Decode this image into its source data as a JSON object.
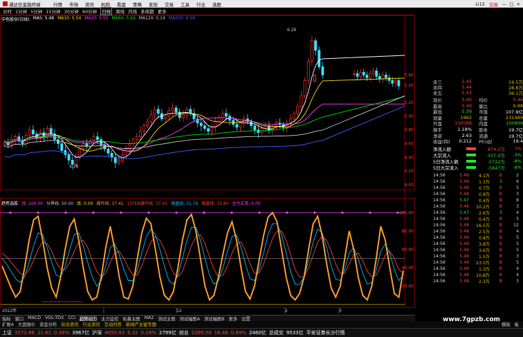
{
  "menubar": {
    "app_title": "通达信金融终端",
    "items": [
      "行情",
      "市场",
      "资讯",
      "机构",
      "看盘",
      "策略",
      "发现",
      "交易",
      "工具",
      "行业",
      "选股"
    ],
    "account": "Li12",
    "trade_label": "交易",
    "window_controls": [
      "—",
      "□",
      "×"
    ]
  },
  "periods": {
    "items": [
      "分时",
      "1分钟",
      "5分钟",
      "15分钟",
      "30分钟",
      "60分钟",
      "日线",
      "周线",
      "月线",
      "多周期",
      "更多"
    ],
    "selected": "日线"
  },
  "ma_legend": [
    {
      "text": "中色股份(日线)",
      "color": "#ffffff"
    },
    {
      "text": "MA5: 5.48",
      "color": "#ffffff"
    },
    {
      "text": "MA10: 5.54",
      "color": "#ffe000"
    },
    {
      "text": "MA20: 5.55",
      "color": "#ff40ff"
    },
    {
      "text": "MA60: 5.64",
      "color": "#00e000"
    },
    {
      "text": "MA120: 5.14",
      "color": "#cccccc"
    },
    {
      "text": "MA250: 4.59",
      "color": "#4060ff"
    }
  ],
  "ind_legend": [
    {
      "text": "趋势选股",
      "color": "#ffffff"
    },
    {
      "text": "顶: 100.00",
      "color": "#ff40ff"
    },
    {
      "text": "分界线: 50.00",
      "color": "#cccccc"
    },
    {
      "text": "底: 0.00",
      "color": "#ffe000"
    },
    {
      "text": "操作线: 37.41",
      "color": "#ffa030"
    },
    {
      "text": "10TEN操作线: 37.41",
      "color": "#ff4040"
    },
    {
      "text": "操盘线: 31.79",
      "color": "#00c0ff"
    },
    {
      "text": "操盘线: 33.80",
      "color": "#ff4040"
    },
    {
      "text": "主力买单: 0.00",
      "color": "#ff40ff"
    }
  ],
  "price_axis": [
    "5.60",
    "5.45",
    "5.20",
    "5.00",
    "4.80",
    "4.60",
    "4.40",
    "4.20",
    "4.00"
  ],
  "ind_axis": [
    "100.00",
    "80.00",
    "60.00",
    "40.00",
    "20.00"
  ],
  "price_marks": {
    "high": "6.26",
    "low": "4.28"
  },
  "x_axis": {
    "year": "2022年",
    "months": [
      "12",
      "2",
      "3"
    ]
  },
  "quote": {
    "asks": [
      {
        "label": "卖三",
        "price": "5.45",
        "vol": "19.5万"
      },
      {
        "label": "卖四",
        "price": "5.44",
        "vol": "28.8万"
      },
      {
        "label": "卖五",
        "price": "5.43",
        "vol": "36.1万"
      }
    ],
    "stats": [
      {
        "k1": "现价",
        "v1": "5.40",
        "c1": "red",
        "k2": "均价",
        "v2": "5.46",
        "c2": "red"
      },
      {
        "k1": "最高",
        "v1": "5.49",
        "c1": "red",
        "k2": "量比",
        "v2": "0.98",
        "c2": "yel"
      },
      {
        "k1": "最低",
        "v1": "5.39",
        "c1": "grn",
        "k2": "市值",
        "v2": "107.9亿",
        "c2": "wht"
      },
      {
        "k1": "现量",
        "v1": "1962",
        "c1": "yel",
        "k2": "总量",
        "v2": "231489",
        "c2": "yel"
      },
      {
        "k1": "外盘",
        "v1": "130588",
        "c1": "red",
        "k2": "内盘",
        "v2": "100899",
        "c2": "grn"
      },
      {
        "k1": "换手",
        "v1": "1.18%",
        "c1": "wht",
        "k2": "股本",
        "v2": "19.7亿",
        "c2": "wht"
      },
      {
        "k1": "净资",
        "v1": "2.63",
        "c1": "wht",
        "k2": "流通",
        "v2": "19.7亿",
        "c2": "wht"
      },
      {
        "k1": "收益(四)",
        "v1": "0.212",
        "c1": "wht",
        "k2": "PE(动)",
        "v2": "19.4",
        "c2": "wht"
      }
    ],
    "flows": [
      {
        "k": "净流入额",
        "v": "874.2万",
        "p": "7%",
        "c": "red"
      },
      {
        "k": "大宗流入",
        "v": "-337.0万",
        "p": "-3%",
        "c": "grn"
      },
      {
        "k": "5日净流入额",
        "v": "-5722万",
        "p": "-8%",
        "c": "grn"
      },
      {
        "k": "5日大宗流入",
        "v": "-5647万",
        "p": "-8%",
        "c": "grn"
      }
    ],
    "ticks": [
      {
        "t": "14:56",
        "p": "5.48",
        "q": "4.1万",
        "s": "B",
        "n": "2"
      },
      {
        "t": "14:56",
        "p": "5.48",
        "q": "1.3万",
        "s": "S",
        "n": "6"
      },
      {
        "t": "14:56",
        "p": "5.48",
        "q": "0.7万",
        "s": "B",
        "n": "5"
      },
      {
        "t": "14:56",
        "p": "5.48",
        "q": "0.8万",
        "s": "B",
        "n": "3"
      },
      {
        "t": "14:56",
        "p": "5.47",
        "q": "0.4万",
        "s": "B",
        "n": "8"
      },
      {
        "t": "14:56",
        "p": "5.48",
        "q": "10.2万",
        "s": "B",
        "n": "3"
      },
      {
        "t": "14:56",
        "p": "5.47",
        "q": "2.6万",
        "s": "S",
        "n": "4"
      },
      {
        "t": "14:56",
        "p": "5.48",
        "q": "0.4万",
        "s": "B",
        "n": "5"
      },
      {
        "t": "14:56",
        "p": "5.48",
        "q": "16.5万",
        "s": "B",
        "n": "12"
      },
      {
        "t": "14:56",
        "p": "5.48",
        "q": "2.5万",
        "s": "B",
        "n": "4"
      },
      {
        "t": "14:56",
        "p": "5.48",
        "q": "0.8万",
        "s": "B",
        "n": "5"
      },
      {
        "t": "14:56",
        "p": "5.48",
        "q": "3.8万",
        "s": "B",
        "n": "5"
      },
      {
        "t": "14:56",
        "p": "5.48",
        "q": "3.6万",
        "s": "B",
        "n": "5"
      },
      {
        "t": "14:56",
        "p": "5.48",
        "q": "1.5万",
        "s": "B",
        "n": "3"
      },
      {
        "t": "14:56",
        "p": "5.48",
        "q": "23.0万",
        "s": "B",
        "n": "5"
      },
      {
        "t": "14:56",
        "p": "5.48",
        "q": "1.3万",
        "s": "B",
        "n": "4"
      },
      {
        "t": "14:56",
        "p": "5.48",
        "q": "10.8万",
        "s": "B",
        "n": "4"
      },
      {
        "t": "14:56",
        "p": "5.48",
        "q": "2.3万",
        "s": "B",
        "n": "3"
      }
    ]
  },
  "tabs": [
    "指标",
    "窗口",
    "MACD",
    "VOL-TDX",
    "CCI",
    "趋势动力",
    "主力监控",
    "私募主图",
    "MA2",
    "测试主图",
    "测试幅图A",
    "测试幅图B",
    "更多",
    "设置"
  ],
  "tabs_selected": "趋势动力",
  "tabs2": [
    "扩展A",
    "大盘报价",
    "资金分布",
    "综合资讯",
    "行业资讯",
    "互动问答",
    "新闻产业链专题"
  ],
  "tabs2_right": [
    "模板",
    "板"
  ],
  "status": {
    "items": [
      {
        "text": "上证",
        "c": "wht"
      },
      {
        "text": "3272.86",
        "c": "red"
      },
      {
        "text": "11.61",
        "c": "red"
      },
      {
        "text": "0.36%",
        "c": "red"
      },
      {
        "text": "3967亿",
        "c": "wht"
      },
      {
        "text": "沪深",
        "c": "wht"
      },
      {
        "text": "4050.93",
        "c": "red"
      },
      {
        "text": "6.32",
        "c": "red"
      },
      {
        "text": "0.16%",
        "c": "red"
      },
      {
        "text": "2799亿",
        "c": "wht"
      },
      {
        "text": "创业",
        "c": "wht"
      },
      {
        "text": "2399.50",
        "c": "red"
      },
      {
        "text": "16.46",
        "c": "red"
      },
      {
        "text": "0.69%",
        "c": "red"
      },
      {
        "text": "2460亿",
        "c": "wht"
      },
      {
        "text": "总成交",
        "c": "wht"
      },
      {
        "text": "9533亿",
        "c": "wht"
      },
      {
        "text": "平安证券长沙行情",
        "c": "wht"
      }
    ]
  },
  "watermark": "www.7gpzb.com",
  "chart_data": [
    {
      "type": "candlestick",
      "title": "中色股份(日线)",
      "ylim": [
        3.95,
        6.35
      ],
      "high_label": "6.26",
      "low_label": "4.28",
      "series": [
        {
          "name": "MA5",
          "color": "#ffffff"
        },
        {
          "name": "MA10",
          "color": "#ffe000"
        },
        {
          "name": "MA20",
          "color": "#ff40ff"
        },
        {
          "name": "MA60",
          "color": "#00e000"
        },
        {
          "name": "MA120",
          "color": "#cccccc"
        },
        {
          "name": "MA250",
          "color": "#4060ff"
        }
      ],
      "close": [
        4.62,
        4.58,
        4.66,
        4.7,
        4.64,
        4.6,
        4.72,
        4.8,
        4.74,
        4.68,
        4.76,
        4.7,
        4.82,
        4.74,
        4.66,
        4.6,
        4.5,
        4.44,
        4.36,
        4.3,
        4.4,
        4.52,
        4.6,
        4.56,
        4.64,
        4.7,
        4.66,
        4.58,
        4.52,
        4.46,
        4.4,
        4.32,
        4.36,
        4.44,
        4.52,
        4.6,
        4.66,
        4.7,
        4.78,
        4.86,
        4.92,
        5.02,
        5.1,
        5.04,
        4.96,
        5.0,
        5.08,
        5.12,
        5.06,
        4.98,
        5.02,
        5.1,
        5.04,
        4.96,
        4.9,
        4.86,
        4.82,
        4.78,
        4.84,
        4.92,
        4.98,
        5.04,
        5.0,
        4.94,
        4.88,
        4.84,
        4.9,
        4.96,
        4.92,
        4.86,
        4.8,
        4.76,
        4.82,
        4.86,
        4.8,
        4.84,
        4.9,
        4.88,
        4.84,
        4.9,
        4.96,
        5.04,
        5.14,
        5.3,
        5.52,
        5.8,
        6.1,
        5.96,
        5.72,
        5.6
      ],
      "tail_close": [
        5.62,
        5.58,
        5.64,
        5.6,
        5.56,
        5.62,
        5.66,
        5.58,
        5.54,
        5.6,
        5.56,
        5.52,
        5.48,
        5.52,
        5.44
      ]
    },
    {
      "type": "line",
      "title": "趋势选股",
      "ylim": [
        0,
        110
      ],
      "series": [
        {
          "name": "操作线",
          "color": "#ffa030",
          "values": [
            42,
            30,
            18,
            8,
            14,
            40,
            70,
            92,
            96,
            70,
            40,
            18,
            8,
            30,
            60,
            85,
            93,
            70,
            40,
            14,
            5,
            8,
            30,
            62,
            85,
            60,
            30,
            8,
            6,
            20,
            50,
            78,
            94,
            88,
            60,
            30,
            10,
            5,
            14,
            40,
            70,
            92,
            98,
            80,
            50,
            20,
            5,
            10,
            30,
            55,
            78,
            90,
            70,
            40,
            14,
            6,
            20,
            48,
            75,
            95,
            100,
            90,
            60,
            30,
            10,
            5,
            12,
            30,
            60,
            88,
            96,
            75,
            44,
            18,
            8,
            20,
            50,
            80,
            60,
            30,
            10,
            5,
            20,
            50,
            85,
            70,
            40,
            12,
            8,
            37
          ]
        },
        {
          "name": "操盘线",
          "color": "#00c0ff",
          "values": [
            50,
            44,
            36,
            28,
            24,
            30,
            46,
            64,
            78,
            76,
            62,
            46,
            32,
            30,
            42,
            60,
            76,
            78,
            64,
            46,
            30,
            20,
            26,
            42,
            62,
            66,
            54,
            38,
            26,
            26,
            38,
            56,
            74,
            82,
            76,
            60,
            42,
            26,
            22,
            32,
            50,
            70,
            84,
            84,
            70,
            50,
            32,
            22,
            26,
            40,
            58,
            74,
            76,
            62,
            44,
            28,
            26,
            38,
            56,
            76,
            88,
            88,
            76,
            56,
            36,
            22,
            22,
            30,
            48,
            68,
            82,
            78,
            62,
            42,
            28,
            26,
            38,
            56,
            62,
            50,
            34,
            22,
            24,
            38,
            58,
            66,
            56,
            38,
            26,
            32
          ]
        },
        {
          "name": "操盘线2",
          "color": "#ff4040",
          "values": [
            56,
            52,
            46,
            40,
            34,
            32,
            38,
            48,
            60,
            68,
            66,
            58,
            46,
            38,
            38,
            46,
            58,
            68,
            70,
            62,
            48,
            36,
            30,
            34,
            46,
            56,
            58,
            50,
            40,
            32,
            32,
            42,
            56,
            68,
            74,
            70,
            60,
            46,
            34,
            30,
            36,
            50,
            64,
            74,
            76,
            66,
            52,
            38,
            30,
            32,
            42,
            56,
            66,
            68,
            58,
            44,
            34,
            34,
            44,
            58,
            72,
            80,
            80,
            70,
            54,
            38,
            30,
            30,
            40,
            54,
            68,
            74,
            70,
            58,
            44,
            34,
            34,
            44,
            54,
            56,
            48,
            36,
            30,
            32,
            42,
            54,
            58,
            50,
            38,
            34
          ]
        }
      ]
    }
  ]
}
